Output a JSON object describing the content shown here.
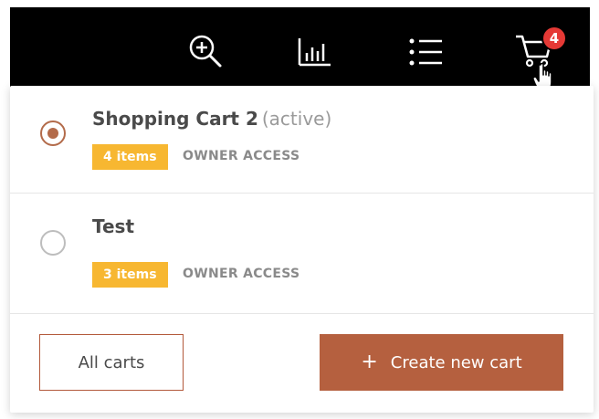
{
  "header": {
    "cart_badge_count": "4",
    "icons": [
      "zoom-in-icon",
      "bar-chart-icon",
      "list-icon",
      "shopping-cart-icon"
    ]
  },
  "carts": [
    {
      "name": "Shopping Cart 2",
      "status": "(active)",
      "items": "4 items",
      "access": "OWNER ACCESS",
      "selected": true
    },
    {
      "name": "Test",
      "status": "",
      "items": "3 items",
      "access": "OWNER ACCESS",
      "selected": false
    }
  ],
  "footer": {
    "all_carts_label": "All carts",
    "create_label": "Create new cart",
    "create_icon": "+"
  },
  "colors": {
    "accent": "#b5603f",
    "tag": "#f7b731",
    "badge": "#e53935"
  }
}
